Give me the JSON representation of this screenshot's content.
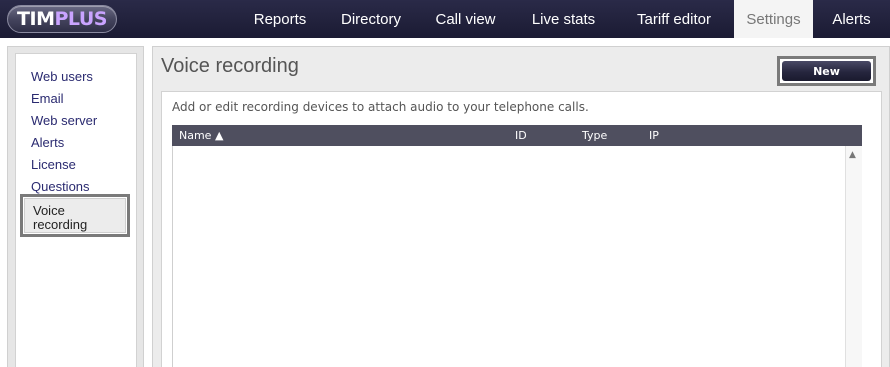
{
  "logo": {
    "part1": "TIM",
    "part2": "PLUS"
  },
  "nav": {
    "items": [
      "Reports",
      "Directory",
      "Call view",
      "Live stats",
      "Tariff editor",
      "Settings",
      "Alerts"
    ],
    "active": "Settings"
  },
  "sidebar": {
    "items": [
      {
        "label": "Web users"
      },
      {
        "label": "Email"
      },
      {
        "label": "Web server"
      },
      {
        "label": "Alerts"
      },
      {
        "label": "License"
      },
      {
        "label": "Questions"
      }
    ],
    "active_line1": "Voice",
    "active_line2": "recording"
  },
  "main": {
    "title": "Voice recording",
    "new_button": "New",
    "description": "Add or edit recording devices to attach audio to your telephone calls.",
    "table": {
      "columns": [
        "Name ▲",
        "ID",
        "Type",
        "IP"
      ],
      "rows": []
    }
  },
  "icons": {
    "scroll_up": "▲"
  },
  "colors": {
    "nav_bg": "#1b1b33",
    "accent_purple": "#c9a3ff",
    "table_header": "#4f4f5f"
  }
}
